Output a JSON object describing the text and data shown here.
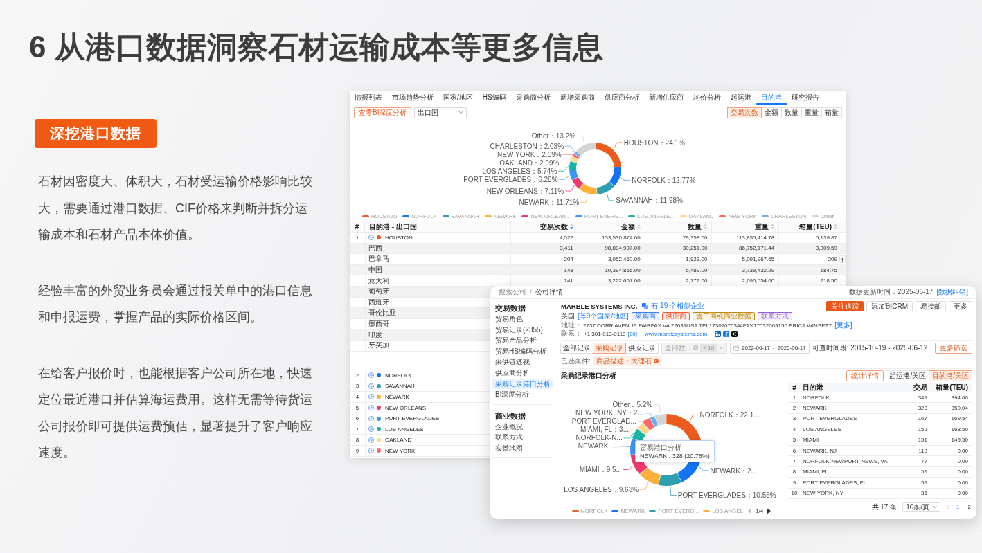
{
  "title": "6 从港口数据洞察石材运输成本等更多信息",
  "badge": "深挖港口数据",
  "paragraphs": [
    "石材因密度大、体积大，石材受运输价格影响比较大，需要通过港口数据、CIF价格来判断并拆分运输成本和石材产品本体价值。",
    "经验丰富的外贸业务员会通过报关单中的港口信息和申报运费，掌握产品的实际价格区间。",
    "在给客户报价时，也能根据客户公司所在地，快速定位最近港口并估算海运费用。这样无需等待货运公司报价即可提供运费预估，显著提升了客户响应速度。"
  ],
  "port_window": {
    "tabs": [
      {
        "label": "情报列表",
        "selected": false
      },
      {
        "label": "市场趋势分析",
        "selected": false
      },
      {
        "label": "国家/地区",
        "selected": false
      },
      {
        "label": "HS编码",
        "selected": false
      },
      {
        "label": "采购商分析",
        "selected": false
      },
      {
        "label": "新增采购商",
        "selected": false
      },
      {
        "label": "供应商分析",
        "selected": false
      },
      {
        "label": "新增供应商",
        "selected": false
      },
      {
        "label": "均价分析",
        "selected": false
      },
      {
        "label": "起运港",
        "selected": false
      },
      {
        "label": "目的港",
        "selected": true
      },
      {
        "label": "研究报告",
        "selected": false
      }
    ],
    "bi_button": "查看BI深度分析",
    "dimension_select": {
      "value": "出口国"
    },
    "metric_buttons": [
      {
        "label": "交易次数",
        "selected": true
      },
      {
        "label": "金额",
        "selected": false
      },
      {
        "label": "数量",
        "selected": false
      },
      {
        "label": "重量",
        "selected": false
      },
      {
        "label": "箱量",
        "selected": false
      }
    ],
    "chart": {
      "chart_data": {
        "type": "donut",
        "values": [
          24.1,
          12.77,
          11.98,
          11.71,
          7.11,
          6.28,
          5.74,
          2.99,
          2.09,
          2.03,
          13.2
        ],
        "value_labels": [
          "HOUSTON：24.1%",
          "NORFOLK：12.77%",
          "SAVANNAH：11.98%",
          "NEWARK：11.71%",
          "NEW ORLEANS：7.11%",
          "PORT EVERGLADES：6.28%",
          "LOS ANGELES：5.74%",
          "OAKLAND：2.99%",
          "NEW YORK：2.09%",
          "CHARLESTON：2.03%",
          "Other：13.2%"
        ],
        "colors": [
          "#eb5b1e",
          "#1473f0",
          "#2d9fb1",
          "#fbb03b",
          "#f0386b",
          "#3b95f2",
          "#19b3a3",
          "#fcd98b",
          "#f46a6a",
          "#6aaef2",
          "#d4d4d4"
        ]
      },
      "legend": [
        {
          "label": "HOUSTON",
          "color": "#eb5b1e"
        },
        {
          "label": "NORFOLK",
          "color": "#1473f0"
        },
        {
          "label": "SAVANNAH",
          "color": "#2d9fb1"
        },
        {
          "label": "NEWARK",
          "color": "#fbb03b"
        },
        {
          "label": "NEW ORLEAN...",
          "color": "#f0386b"
        },
        {
          "label": "PORT EVERG...",
          "color": "#3b95f2"
        },
        {
          "label": "LOS ANGELE...",
          "color": "#19b3a3"
        },
        {
          "label": "OAKLAND",
          "color": "#fcd98b"
        },
        {
          "label": "NEW YORK",
          "color": "#f46a6a"
        },
        {
          "label": "CHARLESTON",
          "color": "#6aaef2"
        },
        {
          "label": "Other",
          "color": "#d4d4d4"
        }
      ]
    },
    "table": {
      "columns": [
        {
          "label": "#",
          "sortable": false,
          "sorted": false
        },
        {
          "label": "目的港 - 出口国",
          "sortable": false,
          "sorted": false
        },
        {
          "label": "交易次数",
          "sortable": true,
          "sorted": true
        },
        {
          "label": "金额",
          "sortable": true,
          "sorted": false
        },
        {
          "label": "数量",
          "sortable": true,
          "sorted": false
        },
        {
          "label": "重量",
          "sortable": true,
          "sorted": false
        },
        {
          "label": "箱量(TEU)",
          "sortable": true,
          "sorted": false
        }
      ],
      "rows": [
        {
          "index": "1",
          "expanded": true,
          "color": "#eb5b1e",
          "name": "HOUSTON",
          "cells": [
            "4,522",
            "133,530,874.00",
            "79,358.00",
            "113,855,414.78",
            "5,139.87"
          ],
          "children": [
            {
              "name": "巴西",
              "cells": [
                "3,411",
                "98,884,997.00",
                "30,251.00",
                "86,752,171.44",
                "3,809.59"
              ]
            },
            {
              "name": "巴拿马",
              "cells": [
                "204",
                "3,052,460.00",
                "1,923.00",
                "5,091,967.65",
                "209"
              ]
            },
            {
              "name": "中国",
              "cells": [
                "148",
                "10,394,866.00",
                "5,489.00",
                "3,739,432.29",
                "184.75"
              ]
            },
            {
              "name": "意大利",
              "cells": [
                "141",
                "3,222,667.00",
                "2,772.00",
                "2,696,554.00",
                "218.50"
              ]
            },
            {
              "name": "葡萄牙"
            },
            {
              "name": "西班牙"
            },
            {
              "name": "哥伦比亚"
            },
            {
              "name": "墨西哥"
            },
            {
              "name": "印度"
            },
            {
              "name": "牙买加"
            }
          ]
        },
        {
          "index": "2",
          "expanded": false,
          "color": "#1473f0",
          "name": "NORFOLK"
        },
        {
          "index": "3",
          "expanded": false,
          "color": "#2d9fb1",
          "name": "SAVANNAH"
        },
        {
          "index": "4",
          "expanded": false,
          "color": "#fbb03b",
          "name": "NEWARK"
        },
        {
          "index": "5",
          "expanded": false,
          "color": "#f0386b",
          "name": "NEW ORLEANS"
        },
        {
          "index": "6",
          "expanded": false,
          "color": "#3b95f2",
          "name": "PORT EVERGLADES"
        },
        {
          "index": "7",
          "expanded": false,
          "color": "#19b3a3",
          "name": "LOS ANGELES"
        },
        {
          "index": "8",
          "expanded": false,
          "color": "#fcd98b",
          "name": "OAKLAND"
        },
        {
          "index": "9",
          "expanded": false,
          "color": "#f46a6a",
          "name": "NEW YORK"
        }
      ]
    }
  },
  "company_window": {
    "breadcrumb": {
      "items": [
        "搜索公司",
        "公司详情"
      ],
      "separator": "/"
    },
    "update_time": "数据更新时间：2025-06-17",
    "correction_link": "[数据纠错]",
    "sidebar": [
      {
        "heading": "交易数据",
        "items": [
          {
            "label": "贸易角色",
            "selected": false
          },
          {
            "label": "贸易记录(2355)",
            "selected": false
          },
          {
            "label": "贸易产品分析",
            "selected": false
          },
          {
            "label": "贸易HS编码分析",
            "selected": false
          },
          {
            "label": "采供链透视",
            "selected": false
          },
          {
            "label": "供应商分析",
            "selected": false
          },
          {
            "label": "采购记录港口分析",
            "selected": true
          },
          {
            "label": "BI深度分析",
            "selected": false
          }
        ]
      },
      {
        "heading": "商业数据",
        "items": [
          {
            "label": "企业概况",
            "selected": false
          },
          {
            "label": "联系方式",
            "selected": false
          },
          {
            "label": "实景地图",
            "selected": false
          }
        ]
      }
    ],
    "company": {
      "name": "MARBLE SYSTEMS INC.",
      "similar_link": "有 19 个相似企业",
      "country": "美国",
      "country_link": "[等9个国家/地区]",
      "tags": [
        {
          "label": "采购商",
          "color": "#3d7ff5"
        },
        {
          "label": "供应商",
          "color": "#f05a3a"
        },
        {
          "label": "含工商或商业数据",
          "color": "#c9870c"
        },
        {
          "label": "联系方式",
          "color": "#9462d8"
        }
      ],
      "address_label": "地址：",
      "address": "2737 DORR AVENUE FAIRFAX VA 22031USA TEL17302076344FAX17032069150 ERICA WINSETT",
      "address_more": "[更多]",
      "contact_label": "联系：",
      "phone": "+1 301-913-9113",
      "phone_more": "[20]",
      "website": "www.marblesystems.com"
    },
    "actions": [
      {
        "label": "关注追踪",
        "kind": "primary"
      },
      {
        "label": "添加到CRM",
        "kind": "default"
      },
      {
        "label": "易接邮",
        "kind": "default"
      },
      {
        "label": "更多",
        "kind": "default"
      }
    ],
    "record_tabs": [
      {
        "label": "全部记录",
        "selected": false
      },
      {
        "label": "采购记录",
        "selected": true
      },
      {
        "label": "供应记录",
        "selected": false
      }
    ],
    "data_select": {
      "value": "全部数...",
      "count": "+ 10",
      "disabled": true
    },
    "date_range": {
      "start": "2022-06-17",
      "separator": "-",
      "end": "2025-06-17"
    },
    "available_period": "可查时间段: 2015-10-19 - 2025-06-12",
    "more_filters": "更多筛选",
    "conditions_label": "已选条件:",
    "conditions": [
      "商品描述：大理石"
    ],
    "section_title": "采购记录港口分析",
    "stats_button": "统计详情",
    "port_toggle": [
      {
        "label": "起运港/关区",
        "selected": false
      },
      {
        "label": "目的港/关区",
        "selected": true
      }
    ],
    "chart": {
      "chart_data": {
        "type": "donut",
        "values": [
          22.12,
          20.78,
          10.58,
          9.63,
          9.57,
          7.48,
          4.88,
          3.74,
          3.74,
          2.28,
          5.2
        ],
        "value_labels": [
          "NORFOLK：22.1...",
          "NEWARK：2...",
          "PORT EVERGLADES：10.58%",
          "LOS ANGELES：9.63%",
          "MIAMI：9.5...",
          "NEWARK, ...",
          "NORFOLK-N...",
          "MIAMI, FL：3...",
          "PORT EVERGLAD...",
          "NEW YORK, NY：2...",
          "Other：5.2%"
        ],
        "colors": [
          "#eb5b1e",
          "#1473f0",
          "#2d9fb1",
          "#fbb03b",
          "#f0386b",
          "#3b95f2",
          "#19b3a3",
          "#fcd98b",
          "#f46a6a",
          "#6aaef2",
          "#d4d4d4"
        ]
      },
      "tooltip": {
        "title": "贸易港口分析",
        "text": "NEWARK : 328 (20.78%)"
      },
      "legend": [
        {
          "label": "NORFOLK",
          "color": "#eb5b1e"
        },
        {
          "label": "NEWARK",
          "color": "#1473f0"
        },
        {
          "label": "PORT EVERG...",
          "color": "#2d9fb1"
        },
        {
          "label": "LOS ANGEL",
          "color": "#fbb03b"
        }
      ],
      "legend_page": "1/4"
    },
    "table": {
      "columns": [
        "#",
        "目的港",
        "交易",
        "箱量(TEU)"
      ],
      "rows": [
        [
          "1",
          "NORFOLK",
          "349",
          "394.60"
        ],
        [
          "2",
          "NEWARK",
          "328",
          "350.04"
        ],
        [
          "3",
          "PORT EVERGLADES",
          "167",
          "169.54"
        ],
        [
          "4",
          "LOS ANGELES",
          "152",
          "168.50"
        ],
        [
          "5",
          "MIAMI",
          "151",
          "149.50"
        ],
        [
          "6",
          "NEWARK, NJ",
          "118",
          "0.00"
        ],
        [
          "7",
          "NORFOLK-NEWPORT NEWS, VA",
          "77",
          "0.00"
        ],
        [
          "8",
          "MIAMI, FL",
          "59",
          "0.00"
        ],
        [
          "9",
          "PORT EVERGLADES, FL",
          "59",
          "0.00"
        ],
        [
          "10",
          "NEW YORK, NY",
          "36",
          "0.00"
        ]
      ]
    },
    "pagination": {
      "total": "共 17 条",
      "page_size": "10条/页",
      "pages": [
        {
          "label": "1",
          "selected": true
        },
        {
          "label": "2",
          "selected": false
        }
      ]
    }
  }
}
